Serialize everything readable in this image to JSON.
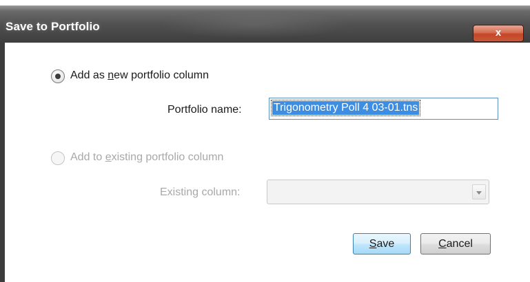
{
  "window": {
    "title": "Save to Portfolio",
    "close_glyph": "x"
  },
  "options": {
    "new_column": {
      "label_pre": "Add as ",
      "label_key": "n",
      "label_post": "ew portfolio column",
      "selected": true,
      "enabled": true
    },
    "existing_column": {
      "label_pre": "Add to ",
      "label_key": "e",
      "label_post": "xisting portfolio column",
      "selected": false,
      "enabled": false
    }
  },
  "portfolio_name": {
    "label": "Portfolio name:",
    "value": "Trigonometry Poll 4 03-01.tns"
  },
  "existing_column": {
    "label": "Existing column:",
    "value": ""
  },
  "buttons": {
    "save_key": "S",
    "save_rest": "ave",
    "cancel_key": "C",
    "cancel_rest": "ancel"
  }
}
